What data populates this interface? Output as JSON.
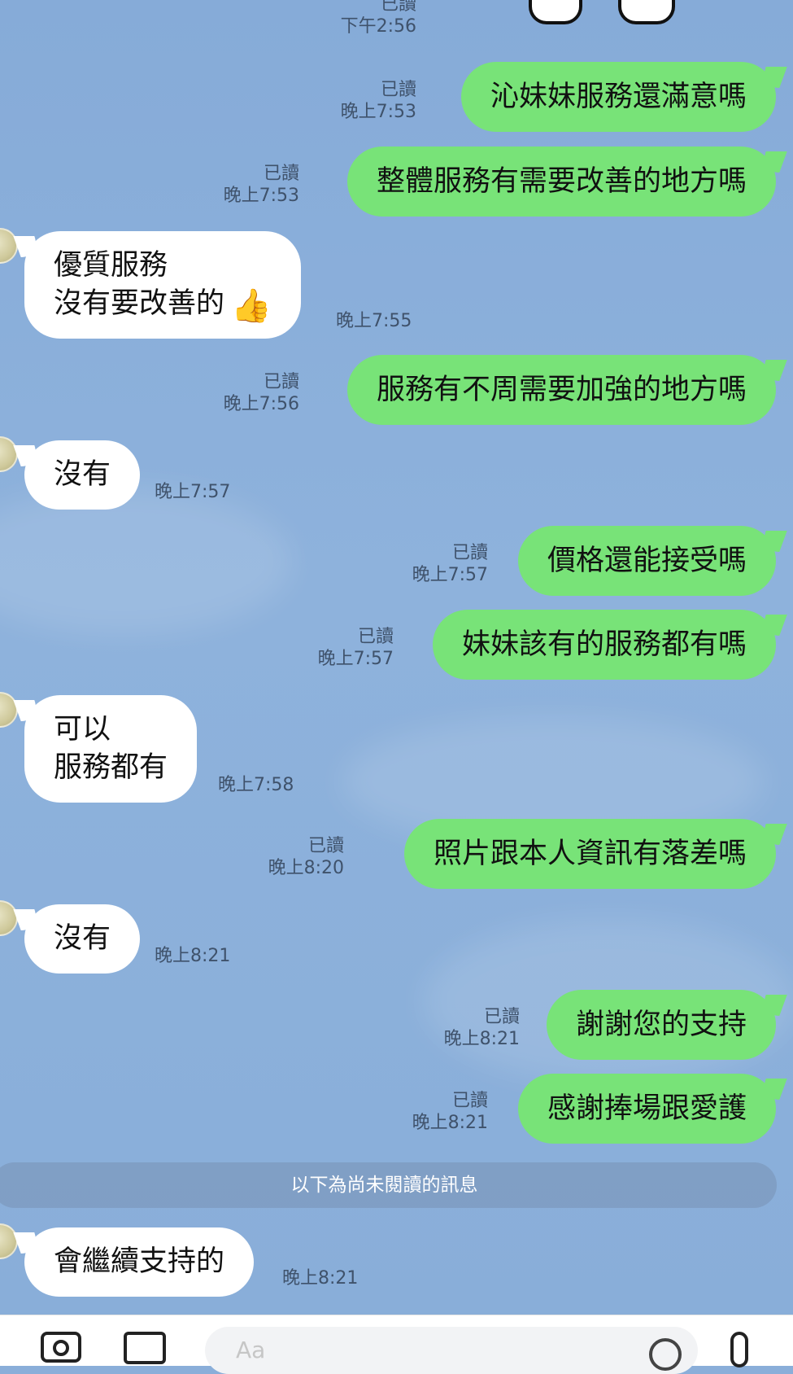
{
  "top": {
    "read_label": "已讀",
    "time": "下午2:56"
  },
  "messages": [
    {
      "dir": "out",
      "text": "沁妹妹服務還滿意嗎",
      "read": "已讀",
      "time": "晚上7:53"
    },
    {
      "dir": "out",
      "text": "整體服務有需要改善的地方嗎",
      "read": "已讀",
      "time": "晚上7:53"
    },
    {
      "dir": "in",
      "lines": [
        "優質服務",
        "沒有要改善的"
      ],
      "emoji": "👍",
      "time": "晚上7:55"
    },
    {
      "dir": "out",
      "text": "服務有不周需要加強的地方嗎",
      "read": "已讀",
      "time": "晚上7:56"
    },
    {
      "dir": "in",
      "lines": [
        "沒有"
      ],
      "time": "晚上7:57"
    },
    {
      "dir": "out",
      "text": "價格還能接受嗎",
      "read": "已讀",
      "time": "晚上7:57"
    },
    {
      "dir": "out",
      "text": "妹妹該有的服務都有嗎",
      "read": "已讀",
      "time": "晚上7:57"
    },
    {
      "dir": "in",
      "lines": [
        "可以",
        "服務都有"
      ],
      "time": "晚上7:58"
    },
    {
      "dir": "out",
      "text": "照片跟本人資訊有落差嗎",
      "read": "已讀",
      "time": "晚上8:20"
    },
    {
      "dir": "in",
      "lines": [
        "沒有"
      ],
      "time": "晚上8:21"
    },
    {
      "dir": "out",
      "text": "謝謝您的支持",
      "read": "已讀",
      "time": "晚上8:21"
    },
    {
      "dir": "out",
      "text": "感謝捧場跟愛護",
      "read": "已讀",
      "time": "晚上8:21"
    },
    {
      "dir": "in",
      "lines": [
        "會繼續支持的"
      ],
      "time": "晚上8:21"
    }
  ],
  "unread_divider": "以下為尚未閱讀的訊息",
  "input": {
    "placeholder": "Aa"
  },
  "icons": [
    "camera-icon",
    "photo-icon",
    "emoji-icon",
    "mic-icon"
  ],
  "colors": {
    "outgoing_bubble": "#78e378",
    "incoming_bubble": "#ffffff",
    "chat_background": "#8aaed9"
  }
}
